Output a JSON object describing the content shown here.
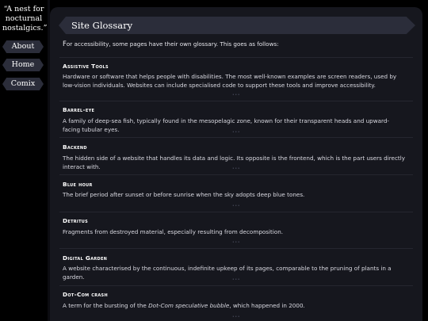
{
  "sidebar": {
    "tagline": "“A nest for nocturnal nostalgics.”",
    "nav": [
      "About",
      "Home",
      "Comix"
    ]
  },
  "page": {
    "title": "Site Glossary",
    "intro_first": "F",
    "intro_rest": "or accessibility, some pages have their own glossary. This goes as follows:"
  },
  "glossary": [
    {
      "term": "Assistive Tools",
      "definition": "Hardware or software that helps people with disabilities. The most well-known examples are screen readers, used by low-vision individuals. Websites can include specialised code to support these tools and improve accessibility."
    },
    {
      "term": "Barrel-eye",
      "definition": "A family of deep-sea fish, typically found in the mesopelagic zone, known for their transparent heads and upward-facing tubular eyes."
    },
    {
      "term": "Backend",
      "definition": "The hidden side of a website that handles its data and logic. Its opposite is the frontend, which is the part users directly interact with."
    },
    {
      "term": "Blue hour",
      "definition": "The brief period after sunset or before sunrise when the sky adopts deep blue tones."
    },
    {
      "term": "Detritus",
      "definition": "Fragments from destroyed material, especially resulting from decomposition."
    },
    {
      "term": "Digital Garden",
      "definition": "A website characterised by the continuous, indefinite upkeep of its pages, comparable to the pruning of plants in a garden."
    },
    {
      "term": "Dot-Com crash",
      "definition_before": "A term for the bursting of the ",
      "definition_em": "Dot-Com speculative bubble",
      "definition_after": ", which happened in 2000."
    }
  ],
  "separator": "•••",
  "colors": {
    "background": "#000000",
    "panel": "#16171e",
    "button": "#2b2d3a",
    "text": "#e8e8ee"
  }
}
